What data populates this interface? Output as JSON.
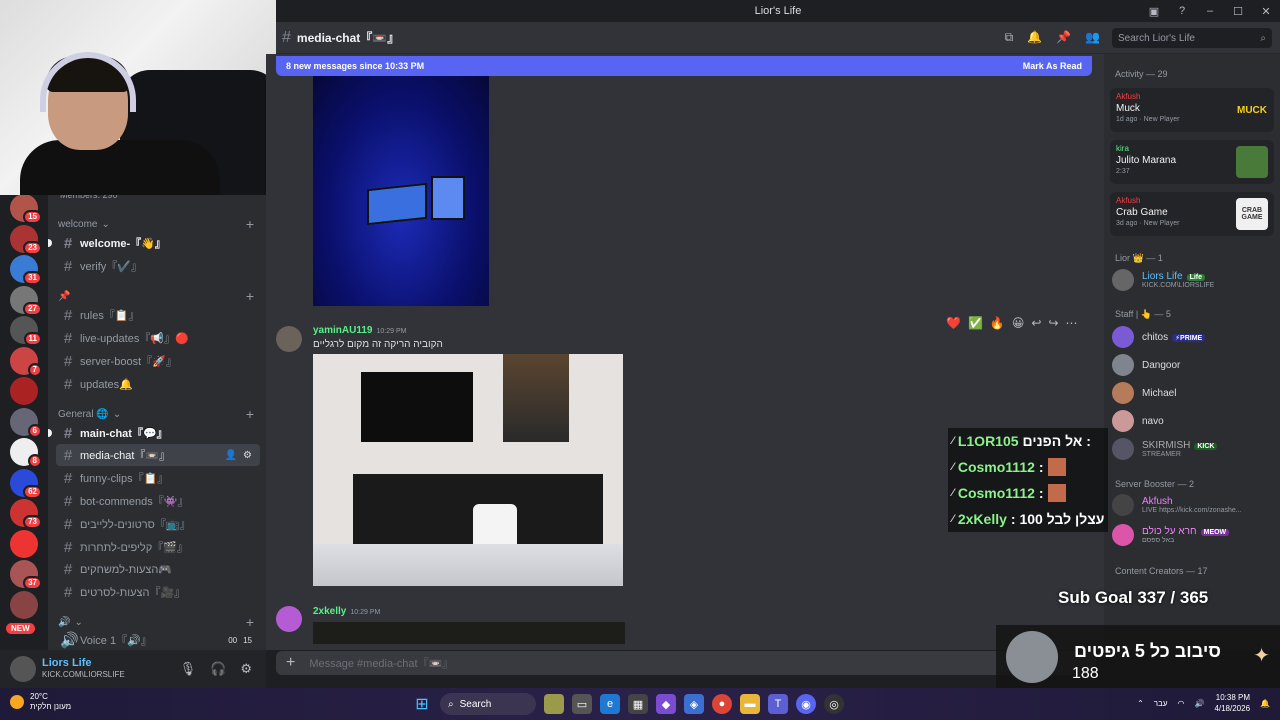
{
  "window": {
    "title": "Lior's Life"
  },
  "header": {
    "channel": "media-chat『📼』"
  },
  "search": {
    "placeholder": "Search Lior's Life"
  },
  "newbar": {
    "text": "8 new messages since 10:33 PM",
    "action": "Mark As Read"
  },
  "rail": {
    "servers": [
      {
        "badge": "15",
        "color": "#b3544a"
      },
      {
        "badge": "23",
        "color": "#a33"
      },
      {
        "badge": "31",
        "color": "#3a7bd5"
      },
      {
        "badge": "27",
        "color": "#777"
      },
      {
        "badge": "11",
        "color": "#555"
      },
      {
        "badge": "7",
        "color": "#c44"
      },
      {
        "badge": "",
        "color": "#a22"
      },
      {
        "badge": "6",
        "color": "#667"
      },
      {
        "badge": "8",
        "color": "#eee"
      },
      {
        "badge": "62",
        "color": "#2b4ad9"
      },
      {
        "badge": "73",
        "color": "#c33"
      },
      {
        "badge": "",
        "color": "#e33"
      },
      {
        "badge": "37",
        "color": "#a55"
      },
      {
        "badge": "",
        "color": "#844"
      }
    ],
    "new_label": "NEW"
  },
  "sidebar": {
    "members_text": "Members: 290",
    "cat_welcome": "welcome",
    "welcome": "welcome-『👋』",
    "verify": "verify『✔️』",
    "cat2": "📌",
    "rules": "rules『📋』",
    "live_updates": "live-updates『📢』🔴",
    "server_boost": "server-boost『🚀』",
    "updates": "updates🔔",
    "cat_general": "General 🌐",
    "main_chat": "main-chat『💬』",
    "media_chat": "media-chat『📼』",
    "funny_clips": "funny-clips『📋』",
    "bot_commends": "bot-commends『👾』",
    "heb1": "סרטונים-ללייבים『📺』",
    "heb2": "קליפים-לתחרות『🎬』",
    "heb3": "הצעות-למשחקים🎮",
    "heb4": "הצעות-לסרטים『🎥』",
    "cat_voice": "🔊",
    "voice1": "Voice 1『🔊』",
    "voice_count_a": "00",
    "voice_count_b": "15"
  },
  "user": {
    "name": "Liors Life",
    "status": "KICK.COM\\LIORSLIFE"
  },
  "messages": [
    {
      "author": "yaminAU119",
      "time": "10:29 PM",
      "text": "הקוביה הריקה זה מקום לרגליים"
    },
    {
      "author": "2xkelly",
      "time": "10:29 PM"
    }
  ],
  "reactions": [
    "❤️",
    "✅",
    "🔥",
    "😀",
    "↩",
    "↪",
    "⋯"
  ],
  "composer": {
    "placeholder": "Message #media-chat『📼』"
  },
  "members": {
    "activity_header": "Activity — 29",
    "cards": [
      {
        "user": "Akfush",
        "game": "Muck",
        "meta": "1d ago · New Player",
        "art": "MUCK"
      },
      {
        "user": "kira",
        "game": "Julito Marana",
        "meta": "2:37",
        "art": ""
      },
      {
        "user": "Akfush",
        "game": "Crab Game",
        "meta": "3d ago · New Player",
        "art": "CRAB GAME"
      }
    ],
    "lior_header": "Lior 👑 — 1",
    "lior": {
      "name": "Liors Life",
      "tag": "Life",
      "status": "KICK.COM\\LIORSLIFE"
    },
    "staff_header": "Staff | 👆 — 5",
    "staff": [
      {
        "name": "chitos",
        "tag": "⚡PRIME"
      },
      {
        "name": "Dangoor",
        "tag": ""
      },
      {
        "name": "Michael",
        "tag": ""
      },
      {
        "name": "navo",
        "tag": ""
      },
      {
        "name": "SKIRMISH",
        "tag": "KICK",
        "status": "STREAMER"
      }
    ],
    "booster_header": "Server Booster — 2",
    "boosters": [
      {
        "name": "Akfush",
        "status": "LIVE https://kick.com/zonashe..."
      },
      {
        "name": "חרא על כולם",
        "tag": "MEOW",
        "status": "באל ספסם"
      }
    ],
    "creators_header": "Content Creators — 17"
  },
  "overlay": {
    "subs": [
      {
        "name": "L1OR105",
        "text": "אל הפנים :"
      },
      {
        "name": "Cosmo1112",
        "text": ":"
      },
      {
        "name": "Cosmo1112",
        "text": ":"
      },
      {
        "name": "2xKelly",
        "text": ": עצלן לבל 100"
      }
    ],
    "sub_goal": "Sub Goal 337 / 365",
    "gift_title": "סיבוב כל 5 גיפטים",
    "gift_count": "188"
  },
  "taskbar": {
    "temp": "20°C",
    "weather": "מעונן חלקית",
    "search": "Search",
    "time": "10:38 PM",
    "date": "4/18/2026",
    "lang": "עבר"
  }
}
